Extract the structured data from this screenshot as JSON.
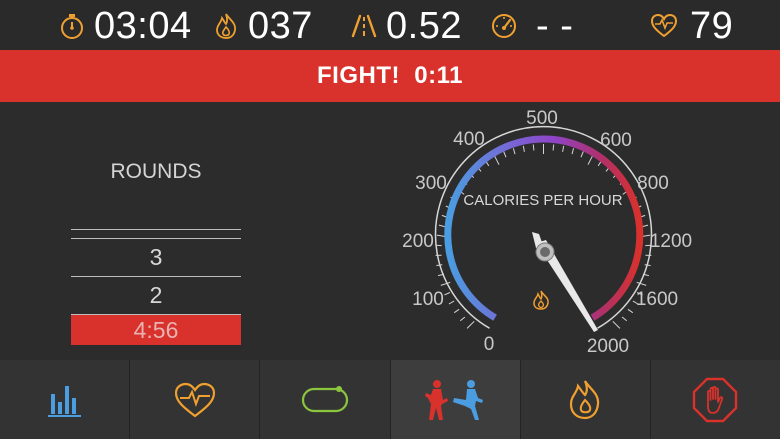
{
  "stats": {
    "timer": {
      "icon": "stopwatch-icon",
      "value": "03:04"
    },
    "calories": {
      "icon": "flame-icon",
      "value": "037"
    },
    "distance": {
      "icon": "road-icon",
      "value": "0.52"
    },
    "speed": {
      "icon": "speedometer-icon",
      "value": "- -"
    },
    "heart_rate": {
      "icon": "heart-rate-icon",
      "value": "79"
    }
  },
  "banner": {
    "text": "FIGHT!  0:11"
  },
  "rounds": {
    "title": "ROUNDS",
    "items": [
      "3",
      "2",
      "4:56"
    ]
  },
  "gauge": {
    "title": "CALORIES PER HOUR",
    "ticks": [
      "0",
      "100",
      "200",
      "300",
      "400",
      "500",
      "600",
      "800",
      "1200",
      "1600",
      "2000"
    ]
  },
  "nav": [
    {
      "icon": "bar-chart-icon"
    },
    {
      "icon": "heart-rate-icon"
    },
    {
      "icon": "rounded-rect-icon"
    },
    {
      "icon": "fighters-icon"
    },
    {
      "icon": "flame-icon"
    },
    {
      "icon": "stop-hand-icon"
    }
  ],
  "colors": {
    "accent_red": "#d9312b",
    "icon_orange": "#f0a030",
    "chart_blue": "#4a9de0",
    "heart_orange": "#f0a030",
    "oval_green": "#8cc63f"
  }
}
